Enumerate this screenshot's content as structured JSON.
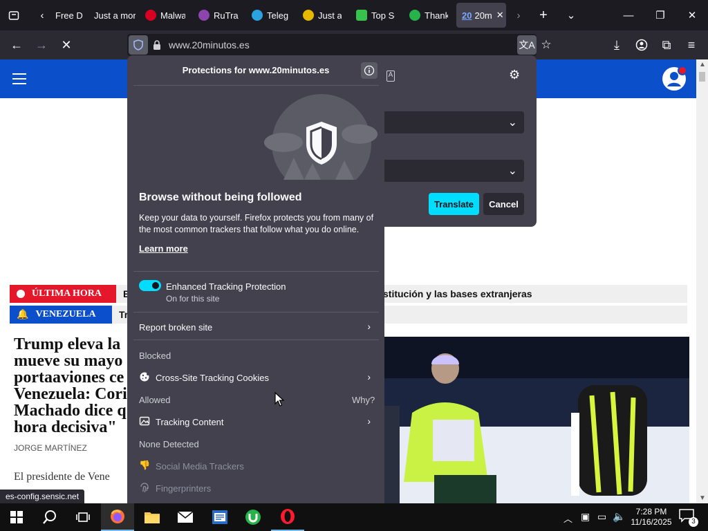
{
  "browser": {
    "tabs": [
      {
        "label": "Free D",
        "color": "#7a7a7a"
      },
      {
        "label": "Just a mor",
        "color": "#7a7a7a"
      },
      {
        "label": "Malwa",
        "color": "#d70022"
      },
      {
        "label": "RuTrac",
        "color": "#8e44ad"
      },
      {
        "label": "Telegr",
        "color": "#2aa3df"
      },
      {
        "label": "Just a",
        "color": "#e6b800"
      },
      {
        "label": "Top Sc",
        "color": "#36c24b"
      },
      {
        "label": "Thank",
        "color": "#27b24a"
      },
      {
        "label": "20m",
        "color": "#0c4fcb",
        "favicon_text": "20"
      }
    ],
    "url": "www.20minutos.es"
  },
  "site": {
    "breaking": [
      {
        "label": "ÚLTIMA HORA",
        "color": "#e4172b",
        "text": "E",
        "cont": "stitución y las bases extranjeras"
      },
      {
        "label": "VENEZUELA",
        "color": "#0c4fcb",
        "text": "Tr",
        "cont": ""
      }
    ],
    "headline": "Trump eleva la mueve su mayo portaaviones ce Venezuela: Cori Machado dice q hora decisiva\"",
    "author": "JORGE MARTÍNEZ",
    "lede": "El presidente de Vene"
  },
  "translate": {
    "translate_label": "Translate",
    "cancel_label": "Cancel",
    "accent": "#00ddff"
  },
  "protections": {
    "title": "Protections for www.20minutos.es",
    "heading": "Browse without being followed",
    "body": "Keep your data to yourself. Firefox protects you from many of the most common trackers that follow what you do online.",
    "learn_more": "Learn more",
    "etp_label": "Enhanced Tracking Protection",
    "etp_state": "On for this site",
    "report": "Report broken site",
    "blocked_header": "Blocked",
    "cross_site": "Cross-Site Tracking Cookies",
    "allowed_header": "Allowed",
    "why": "Why?",
    "tracking_content": "Tracking Content",
    "none_detected": "None Detected",
    "social": "Social Media Trackers",
    "fingerprinters": "Fingerprinters"
  },
  "status_text": "es-config.sensic.net",
  "taskbar": {
    "time": "7:28 PM",
    "date": "11/16/2025",
    "notifications": "3"
  }
}
